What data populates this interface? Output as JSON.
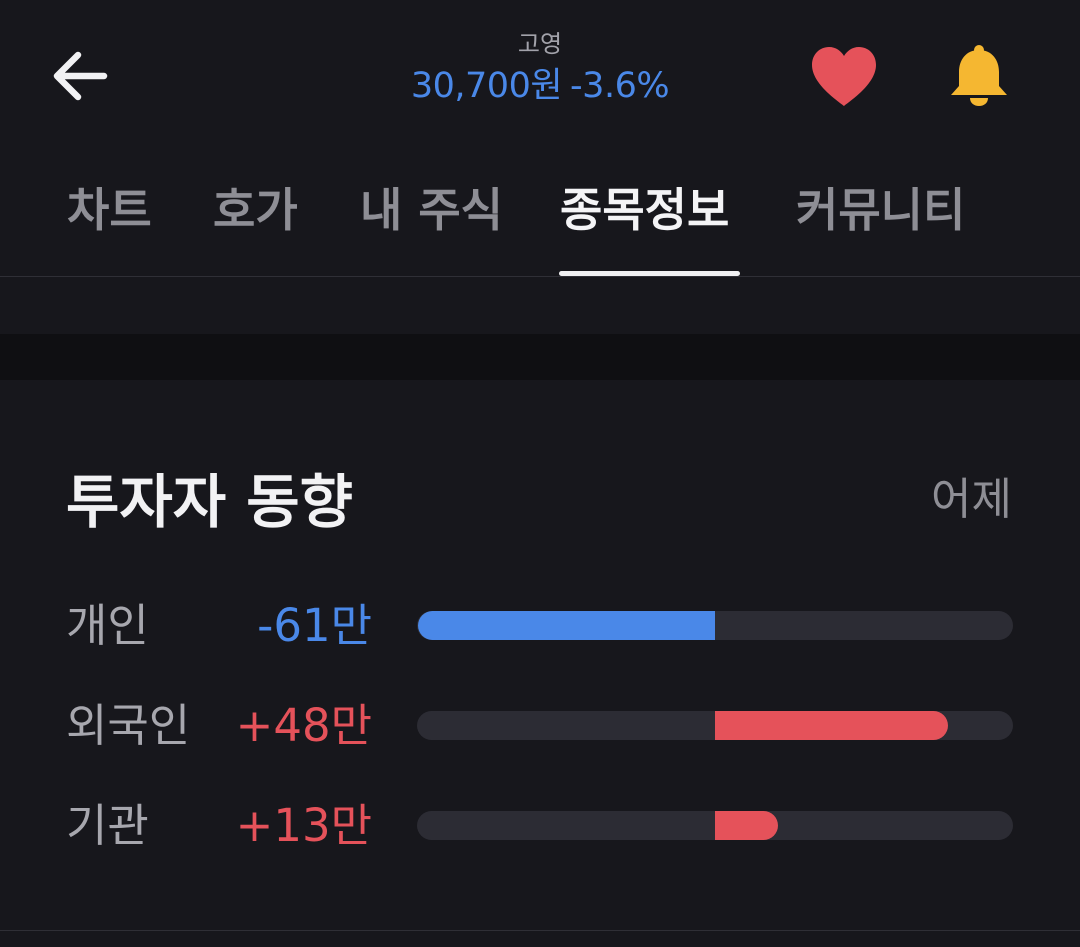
{
  "header": {
    "stock_name": "고영",
    "price": "30,700원",
    "change_pct": "-3.6%",
    "price_color": "#4a88e8",
    "icons": [
      "back-arrow-icon",
      "heart-icon",
      "bell-icon"
    ],
    "heart_color": "#e5525a",
    "bell_color": "#f5b731"
  },
  "tabs": [
    {
      "label": "차트",
      "active": false
    },
    {
      "label": "호가",
      "active": false
    },
    {
      "label": "내 주식",
      "active": false
    },
    {
      "label": "종목정보",
      "active": true
    },
    {
      "label": "커뮤니티",
      "active": false
    }
  ],
  "investor_trend": {
    "title": "투자자 동향",
    "period": "어제",
    "rows": [
      {
        "label": "개인",
        "value": "-61만",
        "amount": -61,
        "color": "#4a88e8"
      },
      {
        "label": "외국인",
        "value": "+48만",
        "amount": 48,
        "color": "#e5525a"
      },
      {
        "label": "기관",
        "value": "+13만",
        "amount": 13,
        "color": "#e5525a"
      }
    ]
  }
}
